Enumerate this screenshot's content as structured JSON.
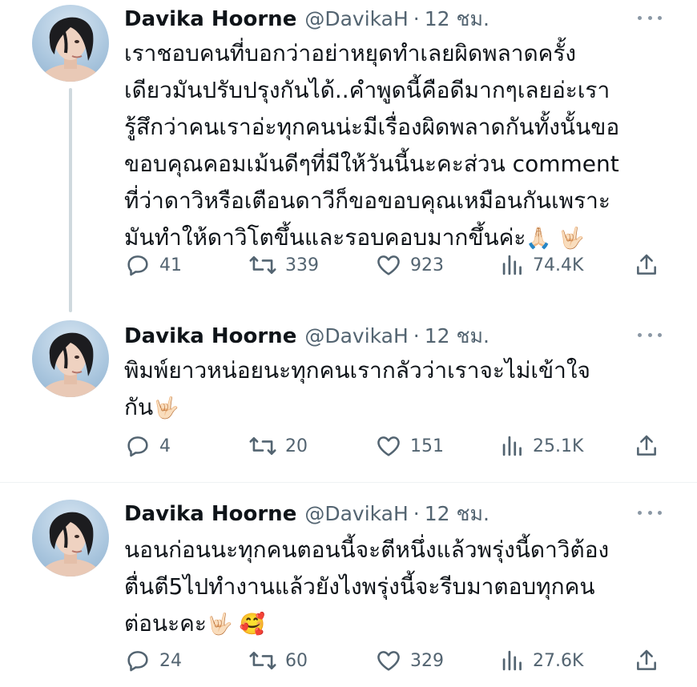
{
  "tweets": [
    {
      "name": "Davika Hoorne",
      "handle": "@DavikaH",
      "separator": "·",
      "time": "12 ชม.",
      "lines": [
        "เราชอบคนที่บอกว่าอย่าหยุดทำเลยผิดพลาดครั้ง",
        "เดียวมันปรับปรุงกันได้..คำพูดนี้คือดีมากๆเลยอ่ะเรา",
        "รู้สึกว่าคนเราอ่ะทุกคนน่ะมีเรื่องผิดพลาดกันทั้งนั้นขอ",
        "ขอบคุณคอมเม้นดีๆที่มีให้วันนี้นะคะส่วน comment",
        "ที่ว่าดาวิหรือเตือนดาวีก็ขอขอบคุณเหมือนกันเพราะ",
        "มันทำให้ดาวิโตขึ้นและรอบคอบมากขึ้นค่ะ"
      ],
      "trailing_emoji": "🙏🏻 🤟🏻",
      "replies": "41",
      "retweets": "339",
      "likes": "923",
      "views": "74.4K"
    },
    {
      "name": "Davika Hoorne",
      "handle": "@DavikaH",
      "separator": "·",
      "time": "12 ชม.",
      "lines": [
        "พิมพ์ยาวหน่อยนะทุกคนเรากลัวว่าเราจะไม่เข้าใจ",
        "กัน"
      ],
      "trailing_emoji": "🤟🏻",
      "replies": "4",
      "retweets": "20",
      "likes": "151",
      "views": "25.1K"
    },
    {
      "name": "Davika Hoorne",
      "handle": "@DavikaH",
      "separator": "·",
      "time": "12 ชม.",
      "lines": [
        "นอนก่อนนะทุกคนตอนนี้จะตีหนึ่งแล้วพรุ่งนี้ดาวิต้อง",
        "ตื่นตี5ไปทำงานแล้วยังไงพรุ่งนี้จะรีบมาตอบทุกคน",
        "ต่อนะคะ"
      ],
      "trailing_emoji": "🤟🏻 🥰",
      "replies": "24",
      "retweets": "60",
      "likes": "329",
      "views": "27.6K"
    }
  ],
  "icons": {
    "reply": "reply-icon",
    "retweet": "retweet-icon",
    "like": "heart-icon",
    "views": "views-icon",
    "share": "share-icon",
    "more": "more-icon"
  },
  "colors": {
    "text": "#0f1419",
    "secondary": "#536471",
    "thread_line": "#cfd9de",
    "divider": "#eff3f4"
  }
}
